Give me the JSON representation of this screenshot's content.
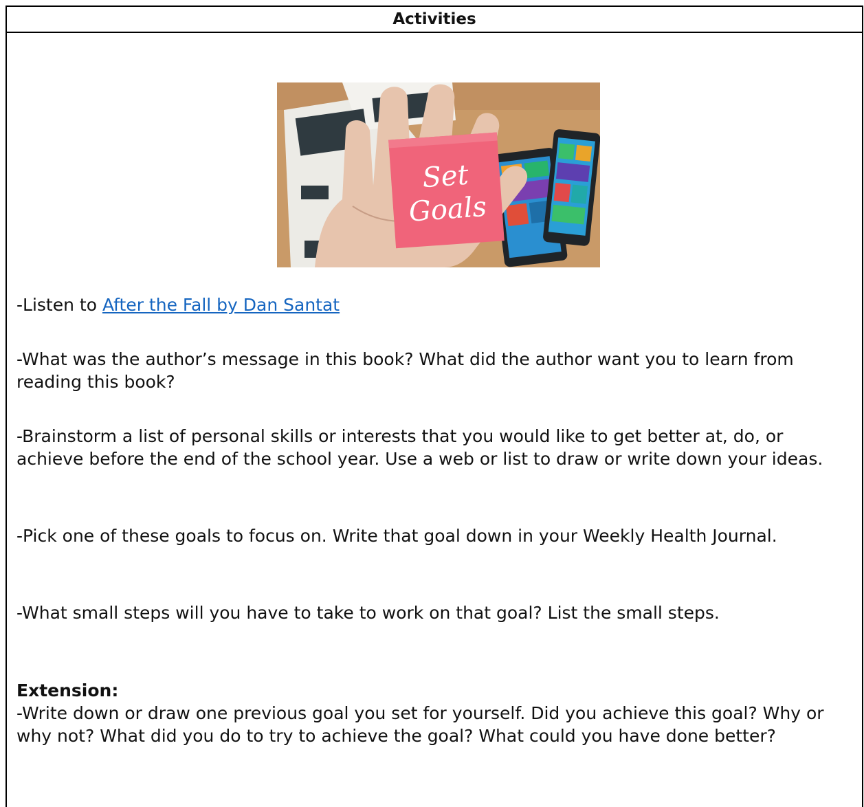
{
  "header": {
    "title": "Activities"
  },
  "image": {
    "note_text_line1": "Set",
    "note_text_line2": "Goals",
    "colors": {
      "background": "#c99a68",
      "note": "#f0647a",
      "skin": "#e7c4ad"
    }
  },
  "activities": {
    "listen_prefix": "-Listen to ",
    "listen_link": "After the Fall by Dan Santat",
    "q1": "-What was the author’s message in this book? What did the author want you to learn from reading this book?",
    "q2": "-Brainstorm a list of personal skills or interests that you would like to get better at, do, or achieve before the end of the school year. Use a web or list to draw or write down your ideas.",
    "q3": "-Pick one of these goals to focus on. Write that goal down in your Weekly Health Journal.",
    "q4": "-What small steps will you have to take to work on that goal? List the small steps."
  },
  "extension": {
    "heading": "Extension:",
    "text": "-Write down or draw one previous goal you set for yourself. Did you achieve this goal? Why or why not? What did you do to try to achieve the goal? What could you have done better?"
  }
}
